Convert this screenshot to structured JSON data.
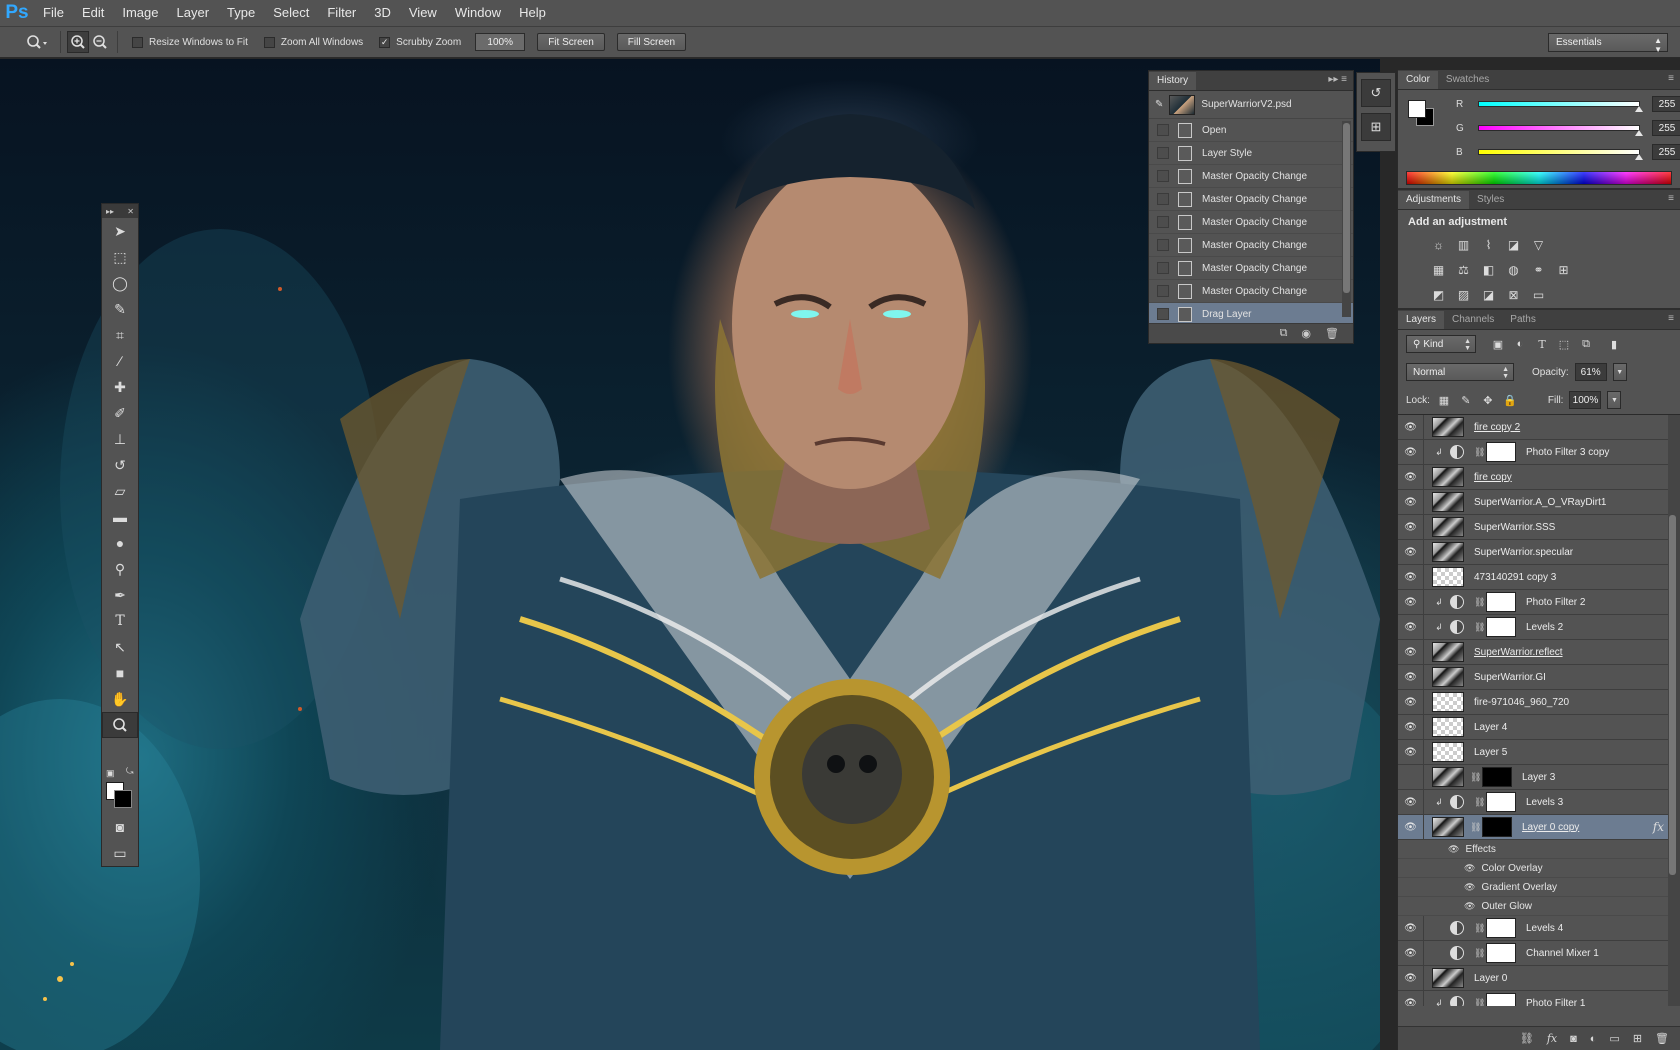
{
  "app": {
    "logo": "Ps"
  },
  "menu": [
    "File",
    "Edit",
    "Image",
    "Layer",
    "Type",
    "Select",
    "Filter",
    "3D",
    "View",
    "Window",
    "Help"
  ],
  "options": {
    "resize_windows": "Resize Windows to Fit",
    "zoom_all": "Zoom All Windows",
    "scrubby": "Scrubby Zoom",
    "zoom_value": "100%",
    "fit_screen": "Fit Screen",
    "fill_screen": "Fill Screen",
    "workspace": "Essentials",
    "resize_checked": false,
    "zoom_all_checked": false,
    "scrubby_checked": true
  },
  "history": {
    "tab": "History",
    "snapshot": "SuperWarriorV2.psd",
    "items": [
      "Open",
      "Layer Style",
      "Master Opacity Change",
      "Master Opacity Change",
      "Master Opacity Change",
      "Master Opacity Change",
      "Master Opacity Change",
      "Master Opacity Change",
      "Drag Layer"
    ],
    "selected_index": 8
  },
  "color_panel": {
    "tabs": [
      "Color",
      "Swatches"
    ],
    "channels": [
      {
        "label": "R",
        "value": "255",
        "color": "#00ffff"
      },
      {
        "label": "G",
        "value": "255",
        "color": "#ff00ff"
      },
      {
        "label": "B",
        "value": "255",
        "color": "#ffff00"
      }
    ]
  },
  "adjustments": {
    "tabs": [
      "Adjustments",
      "Styles"
    ],
    "title": "Add an adjustment"
  },
  "layers_panel": {
    "tabs": [
      "Layers",
      "Channels",
      "Paths"
    ],
    "kind": "Kind",
    "blend_mode": "Normal",
    "opacity_label": "Opacity:",
    "opacity": "61%",
    "lock_label": "Lock:",
    "fill_label": "Fill:",
    "fill": "100%",
    "effects_label": "Effects",
    "effects": [
      "Color Overlay",
      "Gradient Overlay",
      "Outer Glow"
    ],
    "layers": [
      {
        "name": "fire copy 2",
        "type": "photo",
        "underline": true,
        "visible": true
      },
      {
        "name": "Photo Filter 3 copy",
        "type": "adjust",
        "clip": true,
        "visible": true
      },
      {
        "name": "fire copy",
        "type": "photo",
        "underline": true,
        "visible": true
      },
      {
        "name": "SuperWarrior.A_O_VRayDirt1",
        "type": "photo",
        "visible": true
      },
      {
        "name": "SuperWarrior.SSS",
        "type": "photo",
        "visible": true
      },
      {
        "name": "SuperWarrior.specular",
        "type": "photo",
        "visible": true
      },
      {
        "name": "473140291 copy 3",
        "type": "checker",
        "visible": true
      },
      {
        "name": "Photo Filter 2",
        "type": "adjust",
        "clip": true,
        "visible": true
      },
      {
        "name": "Levels 2",
        "type": "adjust",
        "clip": true,
        "visible": true
      },
      {
        "name": "SuperWarrior.reflect",
        "type": "photo",
        "underline": true,
        "visible": true
      },
      {
        "name": "SuperWarrior.GI",
        "type": "photo",
        "visible": true
      },
      {
        "name": "fire-971046_960_720",
        "type": "checker",
        "visible": true
      },
      {
        "name": "Layer 4",
        "type": "checker",
        "visible": true
      },
      {
        "name": "Layer 5",
        "type": "checker",
        "visible": true
      },
      {
        "name": "Layer 3",
        "type": "masked-black",
        "visible": false
      },
      {
        "name": "Levels 3",
        "type": "adjust",
        "clip": true,
        "visible": true
      },
      {
        "name": "Layer 0 copy",
        "type": "masked-black",
        "underline": true,
        "selected": true,
        "fx": true,
        "visible": true
      },
      {
        "name": "Levels 4",
        "type": "adjust-noclip",
        "visible": true
      },
      {
        "name": "Channel Mixer 1",
        "type": "adjust-noclip",
        "visible": true
      },
      {
        "name": "Layer 0",
        "type": "photo",
        "visible": true
      },
      {
        "name": "Photo Filter 1",
        "type": "adjust",
        "clip": true,
        "visible": true
      }
    ]
  }
}
